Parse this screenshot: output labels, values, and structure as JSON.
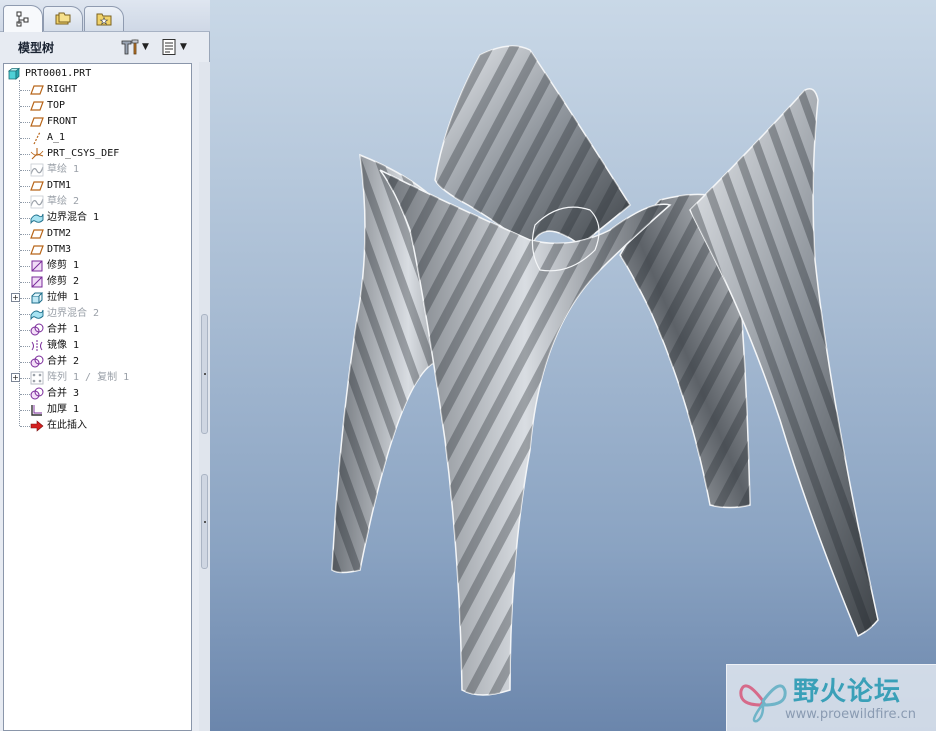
{
  "panel": {
    "tabs": [
      {
        "icon": "model-tree-icon",
        "active": true
      },
      {
        "icon": "folder-browser-icon",
        "active": false
      },
      {
        "icon": "favorites-icon",
        "active": false
      }
    ],
    "title": "模型树"
  },
  "tree": {
    "root": "PRT0001.PRT",
    "items": [
      {
        "label": "RIGHT",
        "icon": "datum-plane-icon",
        "dim": false,
        "expandable": false
      },
      {
        "label": "TOP",
        "icon": "datum-plane-icon",
        "dim": false,
        "expandable": false
      },
      {
        "label": "FRONT",
        "icon": "datum-plane-icon",
        "dim": false,
        "expandable": false
      },
      {
        "label": "A_1",
        "icon": "datum-axis-icon",
        "dim": false,
        "expandable": false
      },
      {
        "label": "PRT_CSYS_DEF",
        "icon": "coordinate-system-icon",
        "dim": false,
        "expandable": false
      },
      {
        "label": "草绘 1",
        "icon": "sketch-icon",
        "dim": true,
        "expandable": false
      },
      {
        "label": "DTM1",
        "icon": "datum-plane-icon",
        "dim": false,
        "expandable": false
      },
      {
        "label": "草绘 2",
        "icon": "sketch-icon",
        "dim": true,
        "expandable": false
      },
      {
        "label": "边界混合 1",
        "icon": "boundary-blend-icon",
        "dim": false,
        "expandable": false
      },
      {
        "label": "DTM2",
        "icon": "datum-plane-icon",
        "dim": false,
        "expandable": false
      },
      {
        "label": "DTM3",
        "icon": "datum-plane-icon",
        "dim": false,
        "expandable": false
      },
      {
        "label": "修剪 1",
        "icon": "trim-icon",
        "dim": false,
        "expandable": false
      },
      {
        "label": "修剪 2",
        "icon": "trim-icon",
        "dim": false,
        "expandable": false
      },
      {
        "label": "拉伸 1",
        "icon": "extrude-icon",
        "dim": false,
        "expandable": true
      },
      {
        "label": "边界混合 2",
        "icon": "boundary-blend-icon",
        "dim": true,
        "expandable": false
      },
      {
        "label": "合并 1",
        "icon": "merge-icon",
        "dim": false,
        "expandable": false
      },
      {
        "label": "镜像 1",
        "icon": "mirror-icon",
        "dim": false,
        "expandable": false
      },
      {
        "label": "合并 2",
        "icon": "merge-icon",
        "dim": false,
        "expandable": false
      },
      {
        "label": "阵列 1 / 复制 1",
        "icon": "pattern-icon",
        "dim": true,
        "expandable": true
      },
      {
        "label": "合并 3",
        "icon": "merge-icon",
        "dim": false,
        "expandable": false
      },
      {
        "label": "加厚 1",
        "icon": "thicken-icon",
        "dim": false,
        "expandable": false
      },
      {
        "label": "在此插入",
        "icon": "insert-here-arrow-icon",
        "dim": false,
        "expandable": false
      }
    ]
  },
  "watermark": {
    "title": "野火论坛",
    "url": "www.proewildfire.cn"
  },
  "colors": {
    "viewport_top": "#c9d8e7",
    "viewport_bottom": "#6b86ac",
    "dim_text": "#9aa0a8"
  }
}
